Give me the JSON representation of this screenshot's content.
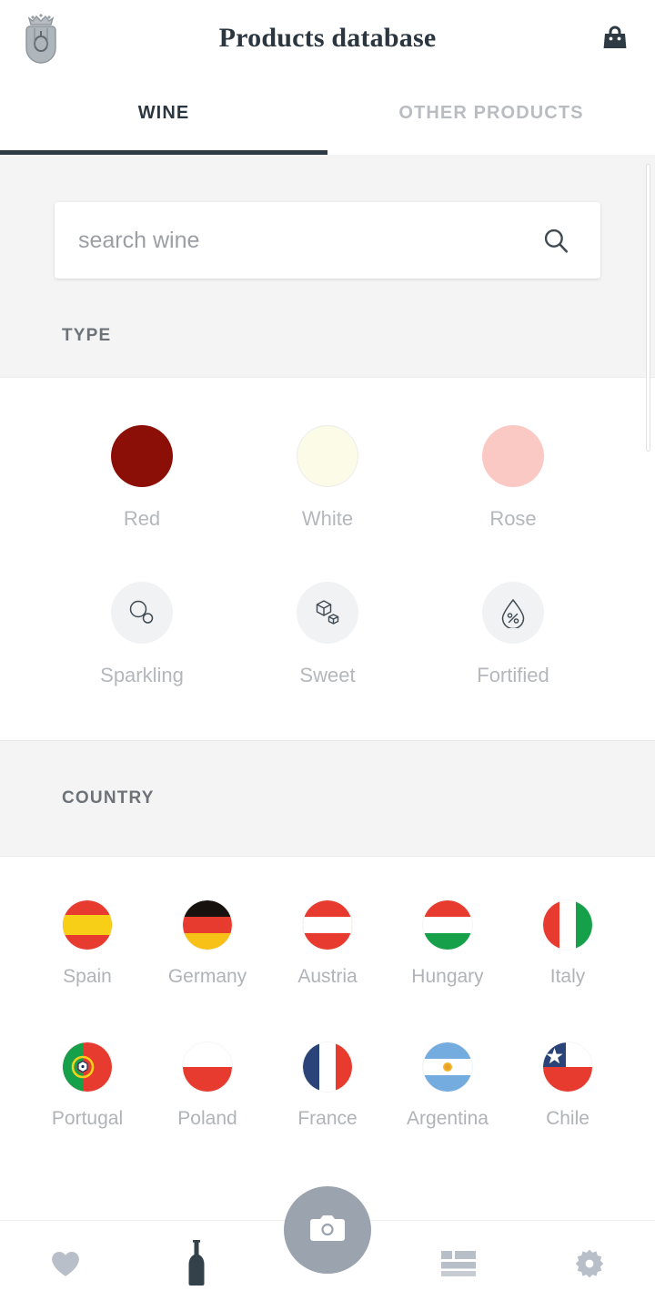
{
  "app": {
    "title": "Products database",
    "logo_icon": "crest-logo-icon",
    "cart_icon": "shopping-bag-icon"
  },
  "tabs": [
    {
      "label": "WINE",
      "active": true
    },
    {
      "label": "OTHER PRODUCTS",
      "active": false
    }
  ],
  "search": {
    "placeholder": "search wine",
    "value": "",
    "icon": "search-icon"
  },
  "sections": {
    "type_label": "TYPE",
    "country_label": "COUNTRY"
  },
  "types": [
    {
      "label": "Red",
      "kind": "swatch",
      "color": "#8b0f06",
      "icon": "red-wine-swatch"
    },
    {
      "label": "White",
      "kind": "swatch",
      "color": "#fbfbe8",
      "icon": "white-wine-swatch"
    },
    {
      "label": "Rose",
      "kind": "swatch",
      "color": "#fbc9c4",
      "icon": "rose-wine-swatch"
    },
    {
      "label": "Sparkling",
      "kind": "icon",
      "color": "#f1f2f3",
      "icon": "bubbles-icon"
    },
    {
      "label": "Sweet",
      "kind": "icon",
      "color": "#f1f2f3",
      "icon": "sugar-cubes-icon"
    },
    {
      "label": "Fortified",
      "kind": "icon",
      "color": "#f1f2f3",
      "icon": "droplet-percent-icon"
    }
  ],
  "countries": [
    {
      "label": "Spain",
      "icon": "flag-spain-icon"
    },
    {
      "label": "Germany",
      "icon": "flag-germany-icon"
    },
    {
      "label": "Austria",
      "icon": "flag-austria-icon"
    },
    {
      "label": "Hungary",
      "icon": "flag-hungary-icon"
    },
    {
      "label": "Italy",
      "icon": "flag-italy-icon"
    },
    {
      "label": "Portugal",
      "icon": "flag-portugal-icon"
    },
    {
      "label": "Poland",
      "icon": "flag-poland-icon"
    },
    {
      "label": "France",
      "icon": "flag-france-icon"
    },
    {
      "label": "Argentina",
      "icon": "flag-argentina-icon"
    },
    {
      "label": "Chile",
      "icon": "flag-chile-icon"
    }
  ],
  "bottom_nav": [
    {
      "icon": "heart-icon",
      "active": false
    },
    {
      "icon": "bottle-icon",
      "active": true
    },
    {
      "icon": "camera-icon",
      "active": false,
      "fab": true
    },
    {
      "icon": "list-icon",
      "active": false
    },
    {
      "icon": "gear-icon",
      "active": false
    }
  ],
  "colors": {
    "accent_dark": "#2e3b44",
    "muted_text": "#b4b7bb",
    "band_bg": "#f4f4f4",
    "fab_bg": "#9aa3ae",
    "nav_inactive": "#b9bfc8"
  }
}
